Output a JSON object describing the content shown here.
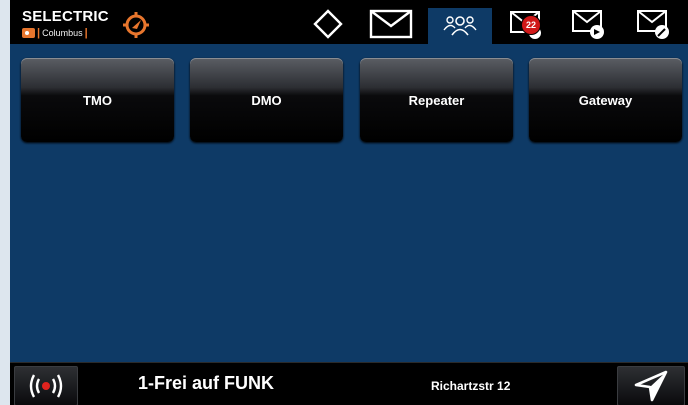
{
  "brand": {
    "title": "SELECTRIC",
    "product": "Columbus",
    "accent_color": "#e8762d"
  },
  "tabs": [
    {
      "name": "diamond-icon"
    },
    {
      "name": "mail-icon"
    },
    {
      "name": "groups-icon",
      "active": true
    },
    {
      "name": "mail-inbox-icon",
      "badge": "22"
    },
    {
      "name": "mail-send-icon"
    },
    {
      "name": "mail-edit-icon"
    }
  ],
  "modes": [
    {
      "label": "TMO"
    },
    {
      "label": "DMO"
    },
    {
      "label": "Repeater"
    },
    {
      "label": "Gateway"
    }
  ],
  "footer": {
    "status": "1-Frei auf FUNK",
    "location": "Richartzstr 12",
    "left_icon": "radio-transmit-icon",
    "right_icon": "navigation-arrow-icon"
  },
  "colors": {
    "background": "#0e3a66",
    "bar": "#000000",
    "badge": "#d01818"
  }
}
